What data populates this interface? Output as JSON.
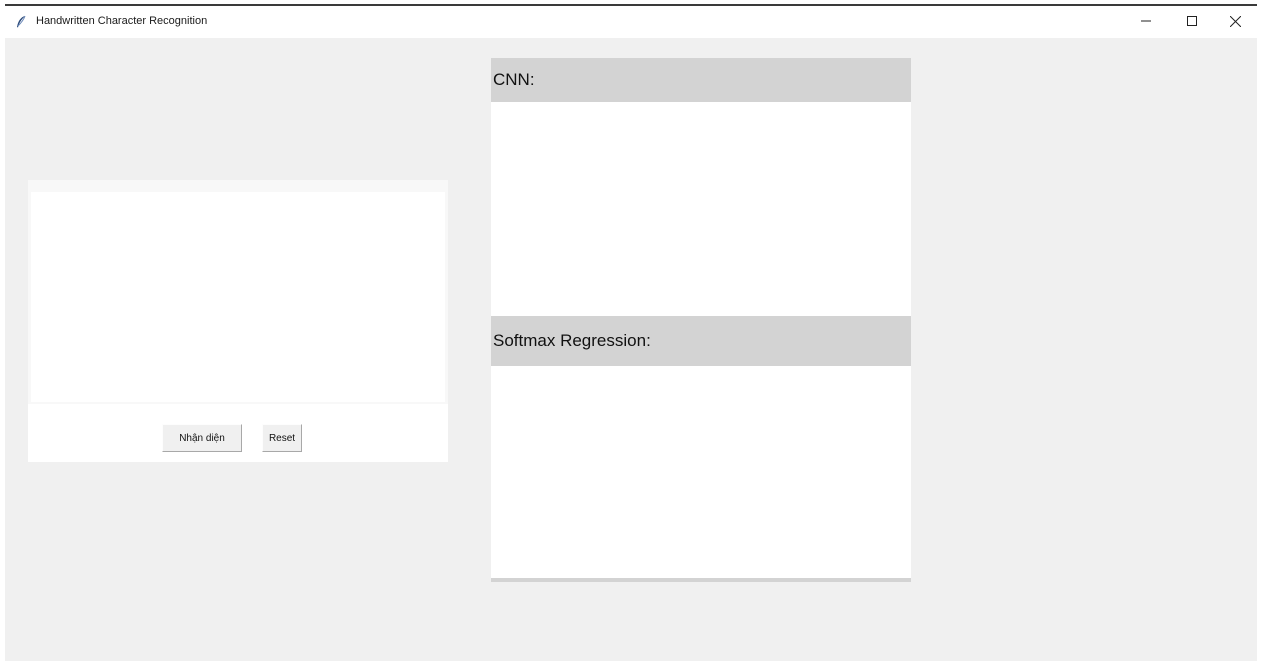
{
  "window": {
    "title": "Handwritten Character Recognition",
    "icon": "feather-icon",
    "controls": {
      "minimize": "minimize-icon",
      "maximize": "maximize-icon",
      "close": "close-icon"
    }
  },
  "drawing_panel": {
    "buttons": {
      "recognize_label": "Nhận diện",
      "reset_label": "Reset"
    }
  },
  "results": {
    "cnn": {
      "label": "CNN:",
      "value": ""
    },
    "softmax": {
      "label": "Softmax Regression:",
      "value": ""
    }
  },
  "colors": {
    "window_bg": "#f0f0f0",
    "header_bg": "#d3d3d3",
    "panel_bg": "#ffffff"
  }
}
